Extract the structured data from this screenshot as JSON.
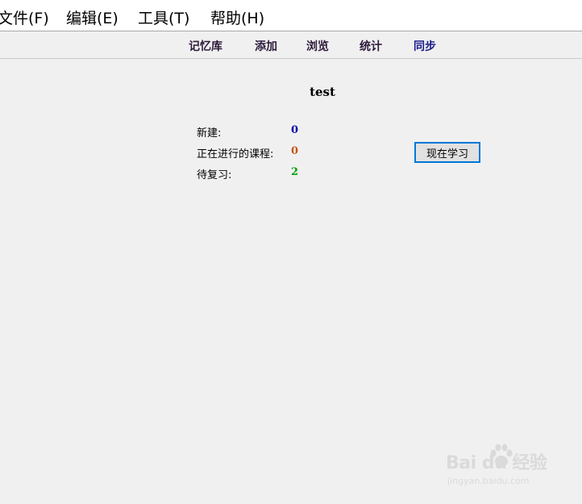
{
  "menubar": {
    "items": [
      {
        "label": "文件(F)"
      },
      {
        "label": "编辑(E)"
      },
      {
        "label": "工具(T)"
      },
      {
        "label": "帮助(H)"
      }
    ]
  },
  "toolbar": {
    "tabs": [
      {
        "label": "记忆库"
      },
      {
        "label": "添加"
      },
      {
        "label": "浏览"
      },
      {
        "label": "统计"
      },
      {
        "label": "同步"
      }
    ]
  },
  "deck": {
    "title": "test",
    "stats": [
      {
        "label": "新建:",
        "value": "0",
        "color": "#0000aa"
      },
      {
        "label": "正在进行的课程:",
        "value": "0",
        "color": "#c35617"
      },
      {
        "label": "待复习:",
        "value": "2",
        "color": "#00a000"
      }
    ],
    "study_button": "现在学习"
  },
  "watermark": {
    "brand": "Bai du 经验",
    "url": "jingyan.baidu.com"
  },
  "colors": {
    "menu_tab_text": "#2c1a3b",
    "sync_tab_text": "#1a1a8c"
  }
}
